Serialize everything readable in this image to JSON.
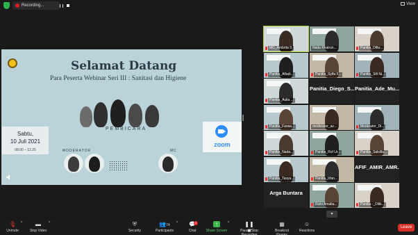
{
  "topbar": {
    "recording_label": "Recording...",
    "view_label": "View"
  },
  "slide": {
    "title": "Selamat Datang",
    "subtitle": "Para Peserta Webinar Seri III :  Sanitasi dan Higiene",
    "pembicara_label": "PEMBICARA",
    "moderator_label": "MODERATOR",
    "mc_label": "MC",
    "date_day": "Sabtu,",
    "date": "10 Juli 2021",
    "time": "08.00 – 12.25",
    "zoom_label": "zoom"
  },
  "gallery": {
    "tiles": [
      {
        "name": "MC_Ambrita S",
        "muted": true,
        "active": true
      },
      {
        "name": "Nada Khairun...",
        "muted": false
      },
      {
        "name": "Panitia_Difia...",
        "muted": true
      },
      {
        "name": "Panitia_Alfadi...",
        "muted": true
      },
      {
        "name": "Panitia_Sylfa F...",
        "muted": true
      },
      {
        "name": "Panitia_Sifi Ni...",
        "muted": true
      },
      {
        "name": "Panitia_Aulia ...",
        "muted": true
      },
      {
        "name": "Panitia_Diego_S...",
        "muted": false,
        "text_only": true
      },
      {
        "name": "Panitia_Ade_Mu...",
        "muted": false,
        "text_only": true
      },
      {
        "name": "Panitia_Farwa...",
        "muted": true
      },
      {
        "name": "moderator_az...",
        "muted": false
      },
      {
        "name": "Moderator_Di...",
        "muted": true
      },
      {
        "name": "Panitia_Nada...",
        "muted": true
      },
      {
        "name": "Panitia_Rof Ur...",
        "muted": true
      },
      {
        "name": "Panitia_Salsilla...",
        "muted": true
      },
      {
        "name": "Panitia_Tasya...",
        "muted": true
      },
      {
        "name": "Panitia_Irfan...",
        "muted": true
      },
      {
        "name": "AFIF_AMIR_AMR...",
        "muted": false,
        "text_only": true
      },
      {
        "name": "Arga Buntara",
        "muted": false,
        "text_only": true
      },
      {
        "name": "Rizki Amalia...",
        "muted": true
      },
      {
        "name": "Panitia -_Dilik...",
        "muted": true
      }
    ]
  },
  "toolbar": {
    "unmute": "Unmute",
    "stop_video": "Stop Video",
    "security": "Security",
    "participants": "Participants",
    "participants_count": "74",
    "chat": "Chat",
    "chat_badge": "2",
    "share_screen": "Share Screen",
    "pause_recording": "Pause/Stop Recording",
    "breakout_rooms": "Breakout Rooms",
    "reactions": "Reactions",
    "leave": "Leave"
  },
  "colors": {
    "accent_green": "#3bb54a",
    "leave_red": "#d93025",
    "zoom_blue": "#2d8cff",
    "active_speaker": "#b6d534"
  }
}
